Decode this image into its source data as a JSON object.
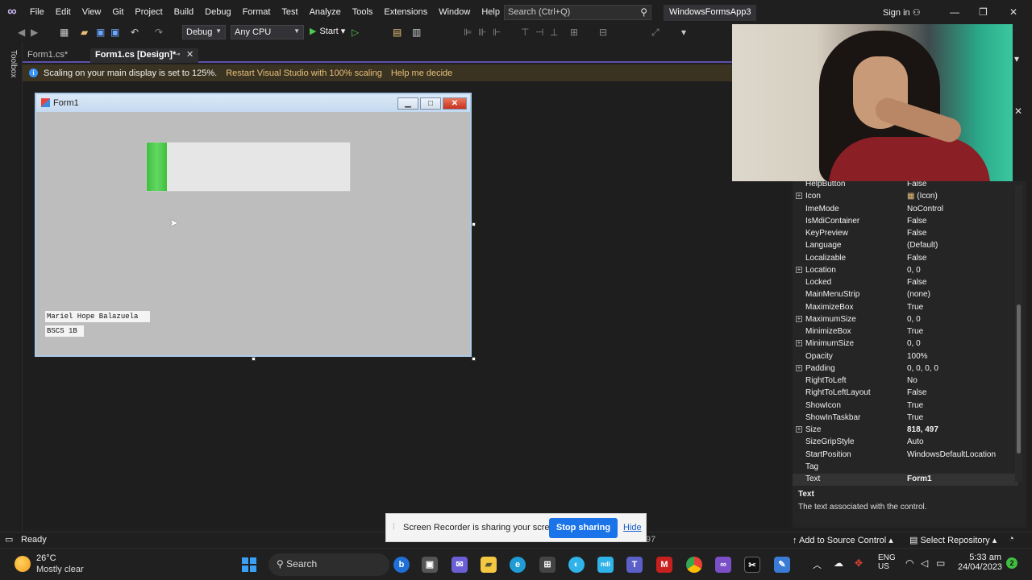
{
  "menubar": {
    "items": [
      "File",
      "Edit",
      "View",
      "Git",
      "Project",
      "Build",
      "Debug",
      "Format",
      "Test",
      "Analyze",
      "Tools",
      "Extensions",
      "Window",
      "Help"
    ],
    "search_placeholder": "Search (Ctrl+Q)",
    "solution_name": "WindowsFormsApp3",
    "signin": "Sign in"
  },
  "toolbar": {
    "config": "Debug",
    "platform": "Any CPU",
    "start_label": "Start"
  },
  "toolbox_label": "Toolbox",
  "tabs": [
    {
      "label": "Form1.cs*"
    },
    {
      "label": "Form1.cs [Design]*"
    }
  ],
  "infobar": {
    "message": "Scaling on your main display is set to 125%.",
    "link1": "Restart Visual Studio with 100% scaling",
    "link2": "Help me decide"
  },
  "form1": {
    "title": "Form1",
    "progress_value": 0.1,
    "label1": "Mariel Hope Balazuela",
    "label2": "BSCS 1B"
  },
  "properties": {
    "rows": [
      {
        "name": "HelpButton",
        "value": "False",
        "expandable": false
      },
      {
        "name": "Icon",
        "value": "(Icon)",
        "expandable": true
      },
      {
        "name": "ImeMode",
        "value": "NoControl",
        "expandable": false
      },
      {
        "name": "IsMdiContainer",
        "value": "False",
        "expandable": false
      },
      {
        "name": "KeyPreview",
        "value": "False",
        "expandable": false
      },
      {
        "name": "Language",
        "value": "(Default)",
        "expandable": false
      },
      {
        "name": "Localizable",
        "value": "False",
        "expandable": false
      },
      {
        "name": "Location",
        "value": "0, 0",
        "expandable": true
      },
      {
        "name": "Locked",
        "value": "False",
        "expandable": false
      },
      {
        "name": "MainMenuStrip",
        "value": "(none)",
        "expandable": false
      },
      {
        "name": "MaximizeBox",
        "value": "True",
        "expandable": false
      },
      {
        "name": "MaximumSize",
        "value": "0, 0",
        "expandable": true
      },
      {
        "name": "MinimizeBox",
        "value": "True",
        "expandable": false
      },
      {
        "name": "MinimumSize",
        "value": "0, 0",
        "expandable": true
      },
      {
        "name": "Opacity",
        "value": "100%",
        "expandable": false
      },
      {
        "name": "Padding",
        "value": "0, 0, 0, 0",
        "expandable": true
      },
      {
        "name": "RightToLeft",
        "value": "No",
        "expandable": false
      },
      {
        "name": "RightToLeftLayout",
        "value": "False",
        "expandable": false
      },
      {
        "name": "ShowIcon",
        "value": "True",
        "expandable": false
      },
      {
        "name": "ShowInTaskbar",
        "value": "True",
        "expandable": false
      },
      {
        "name": "Size",
        "value": "818, 497",
        "expandable": true,
        "bold": true
      },
      {
        "name": "SizeGripStyle",
        "value": "Auto",
        "expandable": false
      },
      {
        "name": "StartPosition",
        "value": "WindowsDefaultLocation",
        "expandable": false
      },
      {
        "name": "Tag",
        "value": "",
        "expandable": false
      },
      {
        "name": "Text",
        "value": "Form1",
        "expandable": false,
        "bold": true,
        "selected": true
      }
    ],
    "desc_title": "Text",
    "desc_text": "The text associated with the control."
  },
  "recorder": {
    "message": "Screen Recorder is sharing your screen.",
    "stop_label": "Stop sharing",
    "hide_label": "Hide"
  },
  "statusbar": {
    "ready": "Ready",
    "size_readout": "8 x 497",
    "source_control": "Add to Source Control",
    "repository": "Select Repository"
  },
  "taskbar": {
    "weather_temp": "26°C",
    "weather_desc": "Mostly clear",
    "search_label": "Search",
    "lang1": "ENG",
    "lang2": "US",
    "time": "5:33 am",
    "date": "24/04/2023",
    "notif_count": "2"
  }
}
